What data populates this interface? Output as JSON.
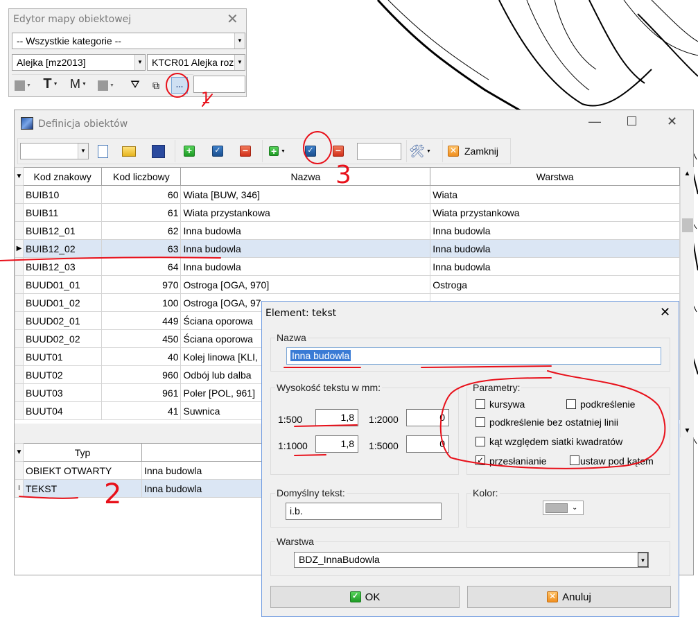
{
  "editor": {
    "title": "Edytor mapy obiektowej",
    "category": "-- Wszystkie kategorie --",
    "lane": "Alejka [mz2013]",
    "code": "KTCR01 Alejka roz"
  },
  "definition": {
    "title": "Definicja obiektów",
    "close_label": "Zamknij",
    "columns": [
      "Kod znakowy",
      "Kod liczbowy",
      "Nazwa",
      "Warstwa"
    ],
    "rows": [
      {
        "code": "BUIB10",
        "num": "60",
        "name": "Wiata [BUW, 346]",
        "layer": "Wiata"
      },
      {
        "code": "BUIB11",
        "num": "61",
        "name": "Wiata przystankowa",
        "layer": "Wiata przystankowa"
      },
      {
        "code": "BUIB12_01",
        "num": "62",
        "name": "Inna budowla",
        "layer": "Inna budowla"
      },
      {
        "code": "BUIB12_02",
        "num": "63",
        "name": "Inna budowla",
        "layer": "Inna budowla"
      },
      {
        "code": "BUIB12_03",
        "num": "64",
        "name": "Inna budowla",
        "layer": "Inna budowla"
      },
      {
        "code": "BUUD01_01",
        "num": "970",
        "name": "Ostroga [OGA, 970]",
        "layer": "Ostroga"
      },
      {
        "code": "BUUD01_02",
        "num": "100",
        "name": "Ostroga [OGA, 97",
        "layer": ""
      },
      {
        "code": "BUUD02_01",
        "num": "449",
        "name": "Ściana oporowa",
        "layer": ""
      },
      {
        "code": "BUUD02_02",
        "num": "450",
        "name": "Ściana oporowa",
        "layer": ""
      },
      {
        "code": "BUUT01",
        "num": "40",
        "name": "Kolej linowa [KLI,",
        "layer": ""
      },
      {
        "code": "BUUT02",
        "num": "960",
        "name": "Odbój lub dalba",
        "layer": ""
      },
      {
        "code": "BUUT03",
        "num": "961",
        "name": "Poler [POL, 961]",
        "layer": ""
      },
      {
        "code": "BUUT04",
        "num": "41",
        "name": "Suwnica",
        "layer": ""
      }
    ],
    "type_column": "Typ",
    "type_rows": [
      {
        "type": "OBIEKT OTWARTY",
        "name": "Inna budowla"
      },
      {
        "type": "TEKST",
        "name": "Inna budowla"
      }
    ]
  },
  "element": {
    "title": "Element: tekst",
    "name_label": "Nazwa",
    "name_value": "Inna budowla",
    "height_label": "Wysokość tekstu w mm:",
    "scales": {
      "s500": "1:500",
      "s500v": "1,8",
      "s2000": "1:2000",
      "s2000v": "0",
      "s1000": "1:1000",
      "s1000v": "1,8",
      "s5000": "1:5000",
      "s5000v": "0"
    },
    "params_label": "Parametry:",
    "params": {
      "italic": "kursywa",
      "underline": "podkreślenie",
      "underline_no_last": "podkreślenie bez ostatniej linii",
      "grid_angle": "kąt względem siatki kwadratów",
      "occlusion": "przesłanianie",
      "set_angle": "ustaw pod kątem"
    },
    "default_text_label": "Domyślny tekst:",
    "default_text": "i.b.",
    "color_label": "Kolor:",
    "layer_label": "Warstwa",
    "layer_value": "BDZ_InnaBudowla",
    "ok": "OK",
    "cancel": "Anuluj"
  },
  "annotations": {
    "n1": "1",
    "n2": "2",
    "n3": "3"
  }
}
